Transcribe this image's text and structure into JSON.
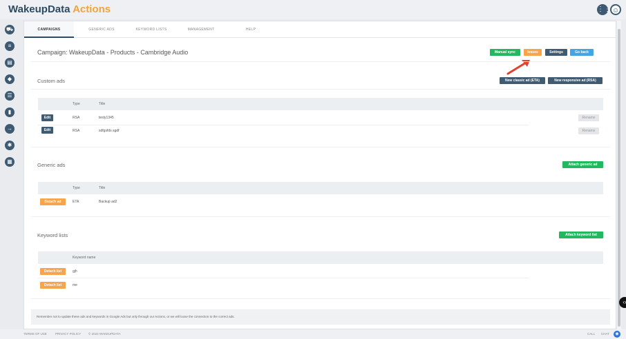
{
  "app": {
    "name_main": "WakeupData",
    "name_accent": "Actions"
  },
  "header_icons": {
    "grid": "grid-icon",
    "user": "user-avatar-icon"
  },
  "sidebar": {
    "items": [
      {
        "icon": "cart-icon",
        "glyph": "⛟"
      },
      {
        "icon": "sliders-icon",
        "glyph": "≡"
      },
      {
        "icon": "layers-icon",
        "glyph": "▤"
      },
      {
        "icon": "tag-icon",
        "glyph": "◆"
      },
      {
        "icon": "list-icon",
        "glyph": "☰"
      },
      {
        "icon": "bar-chart-icon",
        "glyph": "▮"
      },
      {
        "icon": "export-icon",
        "glyph": "→"
      },
      {
        "icon": "gear-icon",
        "glyph": "✱"
      },
      {
        "icon": "document-icon",
        "glyph": "▦"
      }
    ]
  },
  "tabs": [
    "CAMPAIGNS",
    "GENERIC ADS",
    "KEYWORD LISTS",
    "MANAGEMENT",
    "HELP"
  ],
  "campaign": {
    "title": "Campaign: WakeupData - Products - Cambridge Audio"
  },
  "actions": {
    "manual_sync": "Manual sync",
    "issues": "Issues",
    "settings": "Settings",
    "go_back": "Go back"
  },
  "custom_ads": {
    "title": "Custom ads",
    "new_classic": "New classic ad (ETA)",
    "new_responsive": "New responsive ad (RSA)",
    "col_type": "Type",
    "col_title": "Title",
    "rows": [
      {
        "action": "Edit",
        "type": "RSA",
        "title": "testy1345",
        "rename": "Rename"
      },
      {
        "action": "Edit",
        "type": "RSA",
        "title": "sdfgsfds sgdf",
        "rename": "Rename"
      }
    ]
  },
  "generic_ads": {
    "title": "Generic ads",
    "attach": "Attach generic ad",
    "col_type": "Type",
    "col_title": "Title",
    "rows": [
      {
        "action": "Detach ad",
        "type": "ETA",
        "title": "Backup ad2"
      }
    ]
  },
  "keyword_lists": {
    "title": "Keyword lists",
    "attach": "Attach keyword list",
    "col_name": "Keyword name",
    "rows": [
      {
        "action": "Detach list",
        "name": "gjh"
      },
      {
        "action": "Detach list",
        "name": "me"
      }
    ]
  },
  "notice": "Remember not to update these ads and keywords in Google Ads but only through our Actions, or we will loose the connection to the correct ads.",
  "footer": {
    "terms": "TERMS OF USE",
    "privacy": "PRIVACY POLICY",
    "copyright": "© 2022 WAKEUPDATA",
    "call": "CALL",
    "chat": "CHAT"
  },
  "colors": {
    "navy": "#3e5b72",
    "green": "#23b85f",
    "orange": "#f7a44a",
    "blue": "#46a3e4",
    "arrow": "#e2412b"
  }
}
